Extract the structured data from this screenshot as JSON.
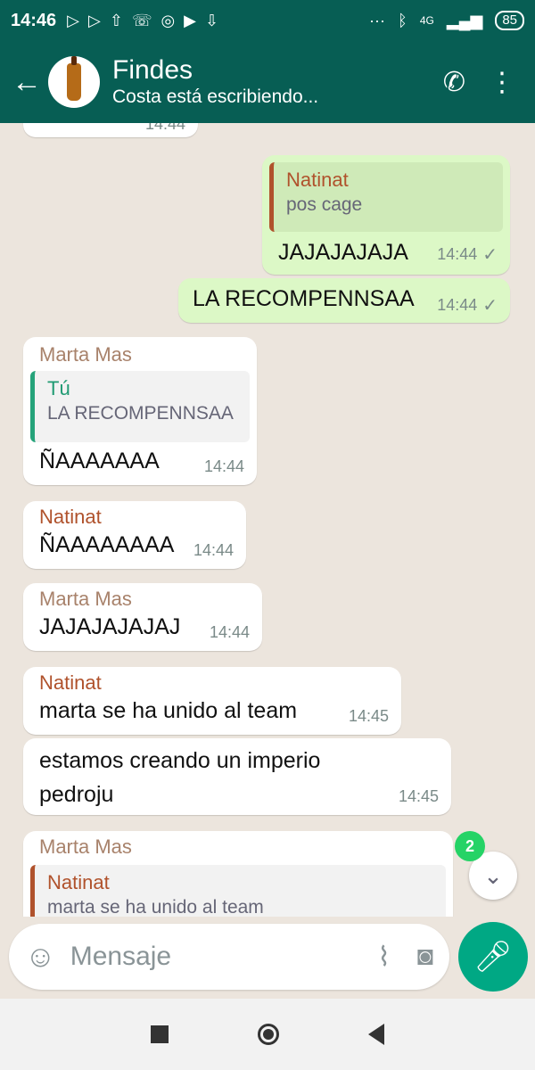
{
  "status_bar": {
    "time": "14:46",
    "network": "4G",
    "battery": "85"
  },
  "header": {
    "title": "Findes",
    "subtitle": "Costa  está escribiendo..."
  },
  "messages": [
    {
      "time": "14:44"
    },
    {
      "quote_name": "Natinat",
      "quote_text": "pos cage",
      "text": "JAJAJAJAJA",
      "time": "14:44"
    },
    {
      "text": "LA RECOMPENNSAA",
      "time": "14:44"
    },
    {
      "sender": "Marta Mas",
      "quote_name": "Tú",
      "quote_text": "LA RECOMPENNSAA",
      "text": "ÑAAAAAAA",
      "time": "14:44"
    },
    {
      "sender": "Natinat",
      "text": "ÑAAAAAAAA",
      "time": "14:44"
    },
    {
      "sender": "Marta Mas",
      "text": "JAJAJAJAJAJ",
      "time": "14:44"
    },
    {
      "sender": "Natinat",
      "text": "marta se ha unido al team",
      "time": "14:45"
    },
    {
      "text": "estamos creando un imperio pedroju",
      "time": "14:45"
    },
    {
      "sender": "Marta Mas",
      "quote_name": "Natinat",
      "quote_text": "marta se ha unido al team"
    }
  ],
  "unread_count": "2",
  "composer": {
    "placeholder": "Mensaje"
  },
  "colors": {
    "header": "#075e54",
    "outgoing": "#dcf8c6",
    "mic": "#00a884",
    "badge": "#25d366"
  }
}
